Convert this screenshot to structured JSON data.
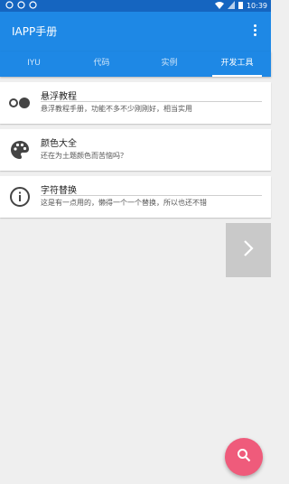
{
  "status": {
    "time": "10:39"
  },
  "appbar": {
    "title": "IAPP手册"
  },
  "tabs": [
    {
      "label": "IYU"
    },
    {
      "label": "代码"
    },
    {
      "label": "实例"
    },
    {
      "label": "开发工具"
    }
  ],
  "items": [
    {
      "title": "悬浮教程",
      "desc": "悬浮教程手册，功能不多不少刚刚好，相当实用",
      "icon": "toggle-icon"
    },
    {
      "title": "颜色大全",
      "desc": "还在为土题颜色而苦恼吗？",
      "icon": "palette-icon"
    },
    {
      "title": "字符替换",
      "desc": "这是有一点用的，懒得一个一个替换，所以也还不错",
      "icon": "info-icon"
    }
  ],
  "colors": {
    "primary": "#1e88e5",
    "statusbar": "#1565c0",
    "fab": "#ef5b7b"
  }
}
